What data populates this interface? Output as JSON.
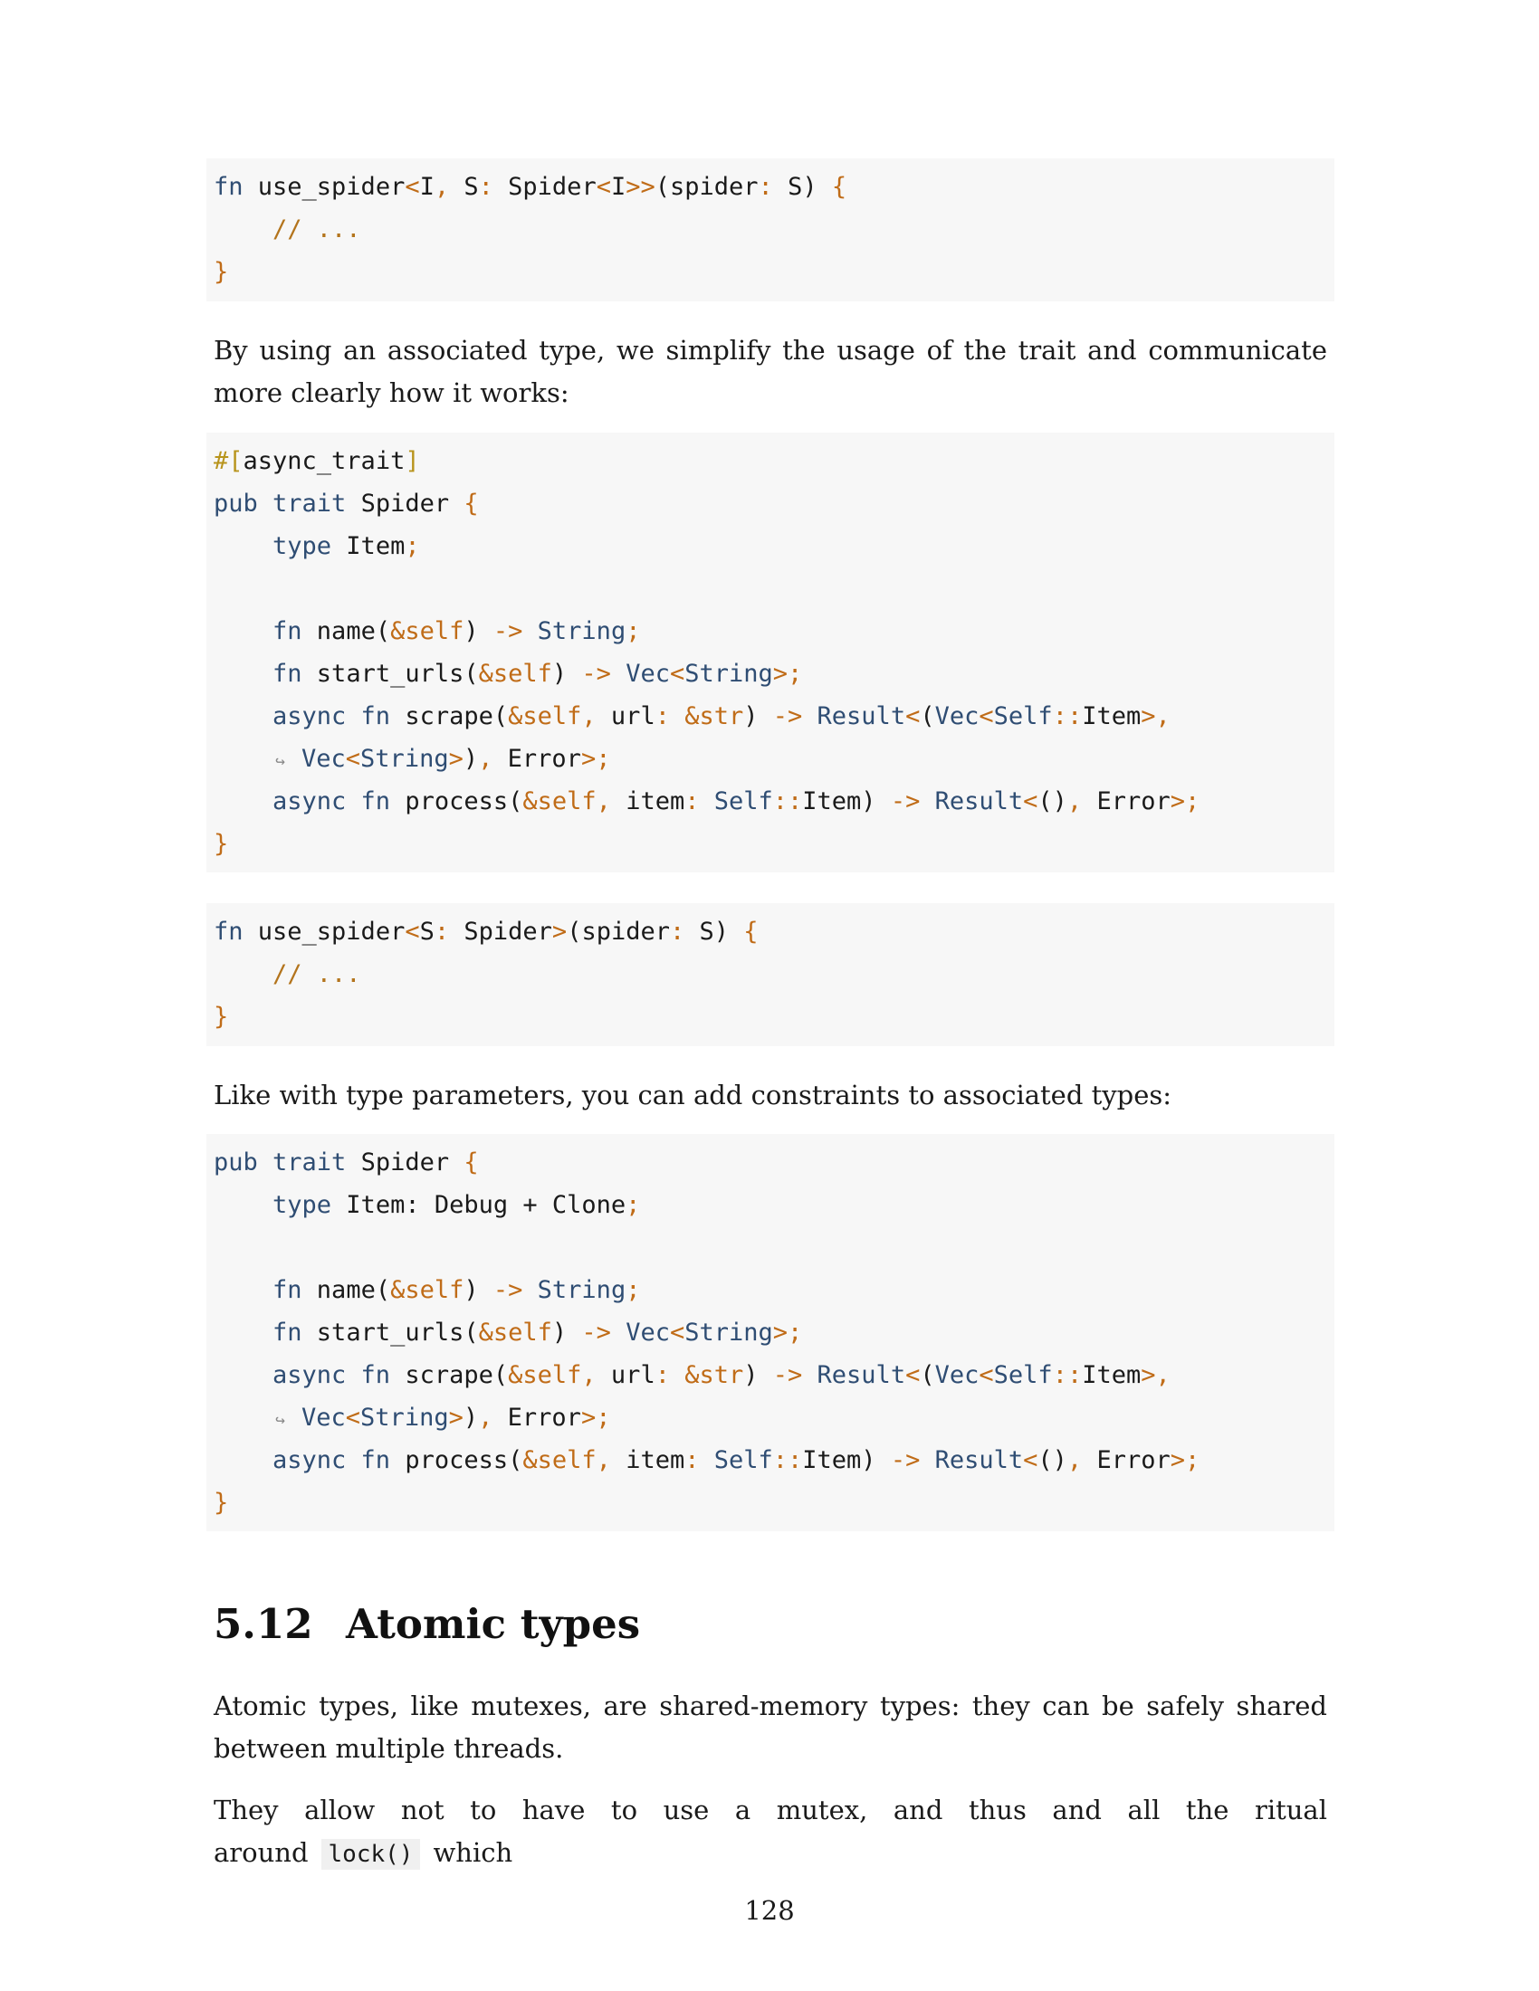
{
  "code1": {
    "line1": {
      "a": "fn",
      "b": " use_spider",
      "c": "<",
      "d": "I",
      "e": ",",
      "f": " S",
      "g": ":",
      "h": " Spider",
      "i": "<",
      "j": "I",
      "k": ">>",
      "l": "(spider",
      "m": ":",
      "n": " S) ",
      "o": "{"
    },
    "line2": {
      "a": "    // ..."
    },
    "line3": {
      "a": "}"
    }
  },
  "para1": {
    "text": "By using an associated type, we simplify the usage of the trait and communicate more clearly how it works:"
  },
  "code2": {
    "line1": {
      "a": "#[",
      "b": "async_trait",
      "c": "]"
    },
    "line2": {
      "a": "pub trait",
      "b": " Spider ",
      "c": "{"
    },
    "line3": {
      "a": "    type",
      "b": " Item",
      "c": ";"
    },
    "line5": {
      "a": "    fn",
      "b": " name(",
      "c": "&self",
      "d": ") ",
      "e": "->",
      "f": " String",
      "g": ";"
    },
    "line6": {
      "a": "    fn",
      "b": " start_urls(",
      "c": "&self",
      "d": ") ",
      "e": "->",
      "f": " Vec",
      "g": "<",
      "h": "String",
      "i": ">;"
    },
    "line7": {
      "a": "    async fn",
      "b": " scrape(",
      "c": "&self",
      "d": ",",
      "e": " url",
      "f": ":",
      "g": " &str",
      "h": ") ",
      "i": "->",
      "j": " Result",
      "k": "<",
      "l": "(",
      "m": "Vec",
      "n": "<",
      "o": "Self",
      "p": "::",
      "q": "Item",
      "r": ">,"
    },
    "line8": {
      "a": "↪",
      "b": "Vec",
      "c": "<",
      "d": "String",
      "e": ">",
      "f": ")",
      "g": ",",
      "h": " Error",
      "i": ">;"
    },
    "line9": {
      "a": "    async fn",
      "b": " process(",
      "c": "&self",
      "d": ",",
      "e": " item",
      "f": ":",
      "g": " Self",
      "h": "::",
      "i": "Item) ",
      "j": "->",
      "k": " Result",
      "l": "<",
      "m": "()",
      "n": ",",
      "o": " Error",
      "p": ">;"
    },
    "line10": {
      "a": "}"
    }
  },
  "code3": {
    "line1": {
      "a": "fn",
      "b": " use_spider",
      "c": "<",
      "d": "S",
      "e": ":",
      "f": " Spider",
      "g": ">",
      "h": "(spider",
      "i": ":",
      "j": " S) ",
      "k": "{"
    },
    "line2": {
      "a": "    // ..."
    },
    "line3": {
      "a": "}"
    }
  },
  "para2": {
    "text": "Like with type parameters, you can add constraints to associated types:"
  },
  "code4": {
    "line1": {
      "a": "pub trait",
      "b": " Spider ",
      "c": "{"
    },
    "line2": {
      "a": "    type",
      "b": " Item: Debug + Clone",
      "c": ";"
    },
    "line4": {
      "a": "    fn",
      "b": " name(",
      "c": "&self",
      "d": ") ",
      "e": "->",
      "f": " String",
      "g": ";"
    },
    "line5": {
      "a": "    fn",
      "b": " start_urls(",
      "c": "&self",
      "d": ") ",
      "e": "->",
      "f": " Vec",
      "g": "<",
      "h": "String",
      "i": ">;"
    },
    "line6": {
      "a": "    async fn",
      "b": " scrape(",
      "c": "&self",
      "d": ",",
      "e": " url",
      "f": ":",
      "g": " &str",
      "h": ") ",
      "i": "->",
      "j": " Result",
      "k": "<",
      "l": "(",
      "m": "Vec",
      "n": "<",
      "o": "Self",
      "p": "::",
      "q": "Item",
      "r": ">,"
    },
    "line7": {
      "a": "↪",
      "b": "Vec",
      "c": "<",
      "d": "String",
      "e": ">",
      "f": ")",
      "g": ",",
      "h": " Error",
      "i": ">;"
    },
    "line8": {
      "a": "    async fn",
      "b": " process(",
      "c": "&self",
      "d": ",",
      "e": " item",
      "f": ":",
      "g": " Self",
      "h": "::",
      "i": "Item) ",
      "j": "->",
      "k": " Result",
      "l": "<",
      "m": "()",
      "n": ",",
      "o": " Error",
      "p": ">;"
    },
    "line9": {
      "a": "}"
    }
  },
  "section": {
    "number": "5.12",
    "title": "Atomic types"
  },
  "para3": {
    "text": "Atomic types, like mutexes, are shared-memory types: they can be safely shared between multiple threads."
  },
  "para4": {
    "before": "They allow not to have to use a mutex, and thus and all the ritual around",
    "code": "lock()",
    "after": "which"
  },
  "page": {
    "number": "128"
  }
}
